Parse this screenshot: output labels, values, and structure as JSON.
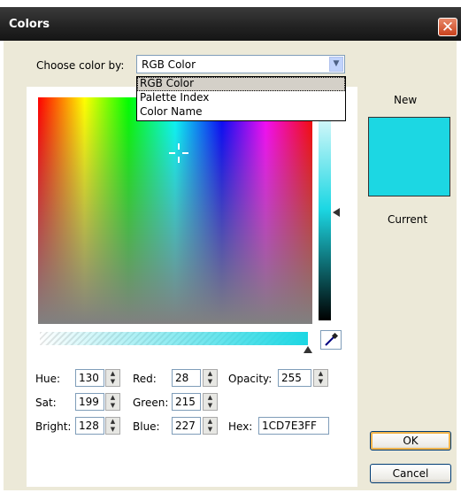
{
  "window": {
    "title": "Colors"
  },
  "choose": {
    "label": "Choose color by:",
    "selected": "RGB Color",
    "options": [
      "RGB Color",
      "Palette Index",
      "Color Name"
    ]
  },
  "preview": {
    "new_label": "New",
    "current_label": "Current",
    "color": "#1CD7E3"
  },
  "fields": {
    "hue": {
      "label": "Hue:",
      "value": "130"
    },
    "sat": {
      "label": "Sat:",
      "value": "199"
    },
    "bright": {
      "label": "Bright:",
      "value": "128"
    },
    "red": {
      "label": "Red:",
      "value": "28"
    },
    "green": {
      "label": "Green:",
      "value": "215"
    },
    "blue": {
      "label": "Blue:",
      "value": "227"
    },
    "opacity": {
      "label": "Opacity:",
      "value": "255"
    },
    "hex": {
      "label": "Hex:",
      "value": "1CD7E3FF"
    }
  },
  "buttons": {
    "ok": "OK",
    "cancel": "Cancel"
  },
  "icons": {
    "close": "close-icon",
    "dropdown": "chevron-down-icon",
    "eyedropper": "eyedropper-icon"
  },
  "colors": {
    "accent": "#1CD7E3",
    "titlebar": "#222222",
    "close": "#C9411C"
  }
}
